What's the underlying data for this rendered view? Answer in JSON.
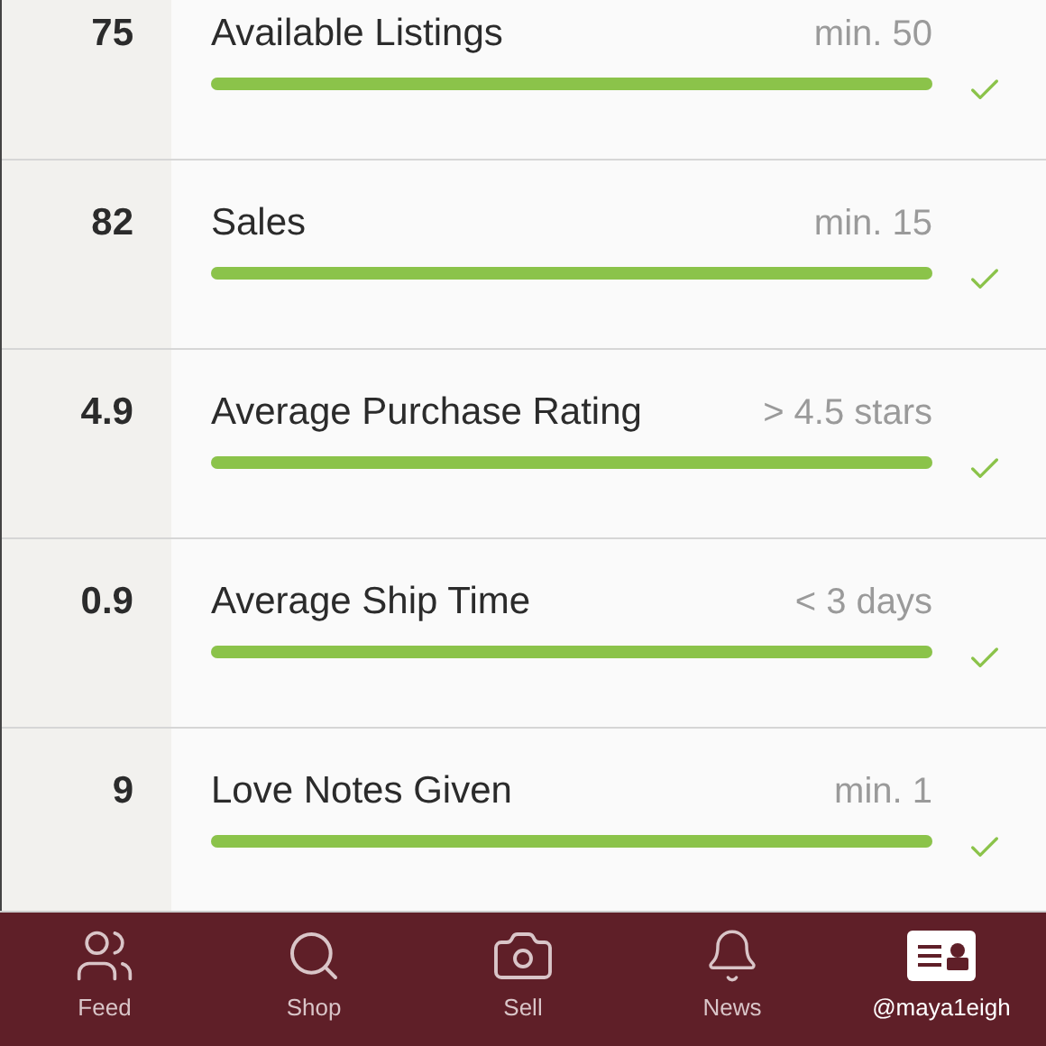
{
  "requirements": [
    {
      "value": "75",
      "label": "Available Listings",
      "target": "min. 50",
      "level": 1,
      "met": true
    },
    {
      "value": "82",
      "label": "Sales",
      "target": "min. 15",
      "level": 1,
      "met": true
    },
    {
      "value": "4.9",
      "label": "Average Purchase Rating",
      "target": "> 4.5 stars",
      "level": 1,
      "met": true
    },
    {
      "value": "0.9",
      "label": "Average Ship Time",
      "target": "< 3 days",
      "level": 1,
      "met": true
    },
    {
      "value": "9",
      "label": "Love Notes Given",
      "target": "min. 1",
      "level": 1,
      "met": true
    }
  ],
  "tab_bar": [
    {
      "kind": "feed",
      "label": "Feed",
      "selected": false
    },
    {
      "kind": "shop",
      "label": "Shop",
      "selected": false
    },
    {
      "kind": "sell",
      "label": "Sell",
      "selected": false
    },
    {
      "kind": "news",
      "label": "News",
      "selected": false
    },
    {
      "kind": "profile",
      "label": "@maya1eigh",
      "selected": true
    }
  ]
}
